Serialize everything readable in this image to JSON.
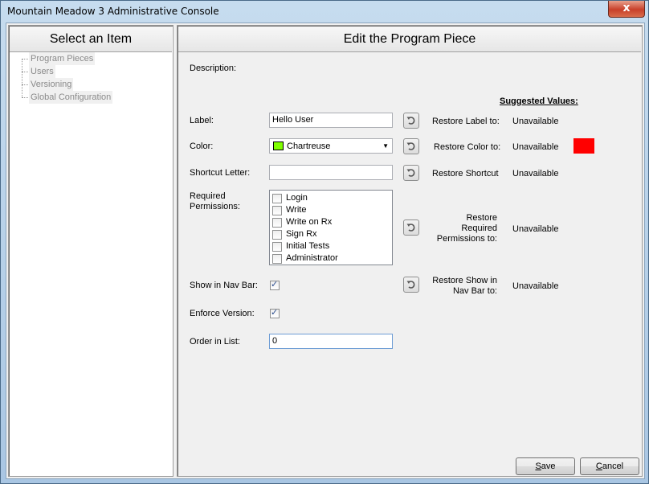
{
  "window": {
    "title": "Mountain Meadow 3 Administrative Console",
    "close_glyph": "x"
  },
  "left_panel": {
    "header": "Select an Item",
    "items": [
      {
        "label": "Program Pieces"
      },
      {
        "label": "Users"
      },
      {
        "label": "Versioning"
      },
      {
        "label": "Global Configuration"
      }
    ]
  },
  "right_panel": {
    "header": "Edit the Program Piece",
    "description_label": "Description:",
    "suggested_values_label": "Suggested Values:",
    "label_field": {
      "label": "Label:",
      "value": "Hello User",
      "restore_label": "Restore Label to:",
      "suggested": "Unavailable"
    },
    "color_field": {
      "label": "Color:",
      "value": "Chartreuse",
      "swatch_color": "#7fff00",
      "restore_label": "Restore Color to:",
      "suggested": "Unavailable",
      "suggested_swatch_color": "#ff0000"
    },
    "shortcut_field": {
      "label": "Shortcut Letter:",
      "value": "",
      "restore_label": "Restore Shortcut",
      "suggested": "Unavailable"
    },
    "permissions_field": {
      "label": "Required Permissions:",
      "options": [
        {
          "label": "Login",
          "checked": false
        },
        {
          "label": "Write",
          "checked": false
        },
        {
          "label": "Write on Rx",
          "checked": false
        },
        {
          "label": "Sign Rx",
          "checked": false
        },
        {
          "label": "Initial Tests",
          "checked": false
        },
        {
          "label": "Administrator",
          "checked": false
        }
      ],
      "restore_label": "Restore Required Permissions to:",
      "suggested": "Unavailable"
    },
    "nav_bar_field": {
      "label": "Show in Nav Bar:",
      "checked": true,
      "restore_label": "Restore Show in Nav Bar to:",
      "suggested": "Unavailable"
    },
    "enforce_version_field": {
      "label": "Enforce Version:",
      "checked": true
    },
    "order_field": {
      "label": "Order in List:",
      "value": "0"
    },
    "save_button": "Save",
    "cancel_button": "Cancel"
  }
}
